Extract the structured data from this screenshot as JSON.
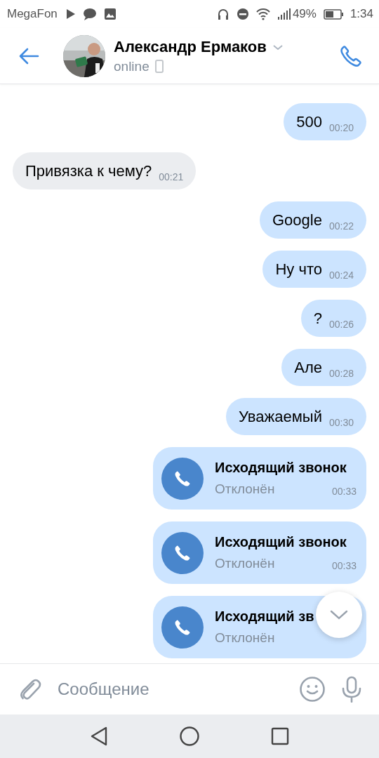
{
  "status_bar": {
    "carrier": "MegaFon",
    "battery": "49%",
    "time": "1:34"
  },
  "header": {
    "name": "Александр Ермаков",
    "presence": "online"
  },
  "messages": [
    {
      "kind": "text",
      "outgoing": true,
      "text": "500",
      "time": "00:20"
    },
    {
      "kind": "text",
      "outgoing": false,
      "text": "Привязка к чему?",
      "time": "00:21"
    },
    {
      "kind": "text",
      "outgoing": true,
      "text": "Google",
      "time": "00:22"
    },
    {
      "kind": "text",
      "outgoing": true,
      "text": "Ну что",
      "time": "00:24"
    },
    {
      "kind": "text",
      "outgoing": true,
      "text": "?",
      "time": "00:26"
    },
    {
      "kind": "text",
      "outgoing": true,
      "text": "Але",
      "time": "00:28"
    },
    {
      "kind": "text",
      "outgoing": true,
      "text": "Уважаемый",
      "time": "00:30"
    },
    {
      "kind": "call",
      "outgoing": true,
      "title": "Исходящий звонок",
      "status": "Отклонён",
      "time": "00:33"
    },
    {
      "kind": "call",
      "outgoing": true,
      "title": "Исходящий звонок",
      "status": "Отклонён",
      "time": "00:33"
    },
    {
      "kind": "call",
      "outgoing": true,
      "title": "Исходящий зв",
      "status": "Отклонён"
    }
  ],
  "composer": {
    "placeholder": "Сообщение"
  }
}
